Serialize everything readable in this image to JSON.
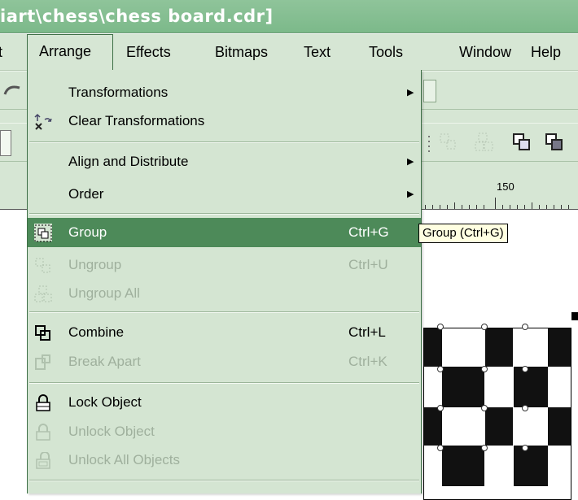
{
  "title_bar": {
    "text": "iart\\chess\\chess board.cdr]"
  },
  "menubar": {
    "items": [
      {
        "label": "t"
      },
      {
        "label": "Arrange"
      },
      {
        "label": "Effects"
      },
      {
        "label": "Bitmaps"
      },
      {
        "label": "Text"
      },
      {
        "label": "Tools"
      },
      {
        "label": "Window"
      },
      {
        "label": "Help"
      }
    ]
  },
  "ruler": {
    "label": "150"
  },
  "menu": {
    "transformations": {
      "label": "Transformations"
    },
    "clear_transformations": {
      "label": "Clear Transformations"
    },
    "align_distribute": {
      "label": "Align and Distribute"
    },
    "order": {
      "label": "Order"
    },
    "group": {
      "label": "Group",
      "shortcut": "Ctrl+G"
    },
    "ungroup": {
      "label": "Ungroup",
      "shortcut": "Ctrl+U"
    },
    "ungroup_all": {
      "label": "Ungroup All"
    },
    "combine": {
      "label": "Combine",
      "shortcut": "Ctrl+L"
    },
    "break_apart": {
      "label": "Break Apart",
      "shortcut": "Ctrl+K"
    },
    "lock_object": {
      "label": "Lock Object"
    },
    "unlock_object": {
      "label": "Unlock Object"
    },
    "unlock_all": {
      "label": "Unlock All Objects"
    }
  },
  "tooltip": {
    "text": "Group (Ctrl+G)"
  },
  "colors": {
    "menu_bg": "#d4e5d2",
    "highlight": "#4d8a59",
    "disabled": "#9fb09d",
    "titlebar": "#7cb98a"
  }
}
